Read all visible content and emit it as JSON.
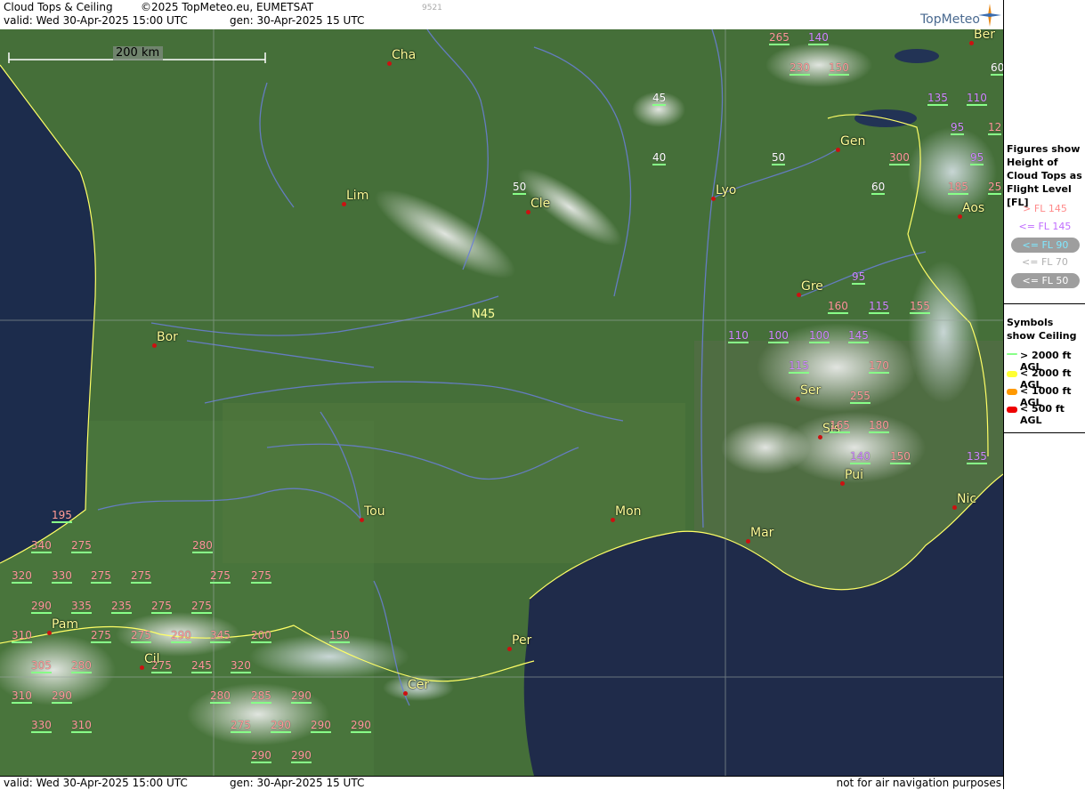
{
  "header": {
    "title": "Cloud Tops & Ceiling",
    "copyright": "©2025 TopMeteo.eu, EUMETSAT",
    "valid": "valid:  Wed  30-Apr-2025  15:00 UTC",
    "generated": "gen: 30-Apr-2025 15 UTC",
    "image_id": "9521",
    "brand": "TopMeteo"
  },
  "map": {
    "scale_label": "200 km",
    "lat_label": "N45",
    "cities": [
      {
        "name": "Cha"
      },
      {
        "name": "Lim"
      },
      {
        "name": "Cle"
      },
      {
        "name": "Lyo"
      },
      {
        "name": "Gen"
      },
      {
        "name": "Ber"
      },
      {
        "name": "Aos"
      },
      {
        "name": "Gre"
      },
      {
        "name": "Bor"
      },
      {
        "name": "Ser"
      },
      {
        "name": "Sis"
      },
      {
        "name": "Pui"
      },
      {
        "name": "Tou"
      },
      {
        "name": "Mon"
      },
      {
        "name": "Mar"
      },
      {
        "name": "Nic"
      },
      {
        "name": "Pam"
      },
      {
        "name": "Cil"
      },
      {
        "name": "Per"
      },
      {
        "name": "Cer"
      }
    ],
    "cloud_tops": [
      {
        "v": "265",
        "c": "pink"
      },
      {
        "v": "140",
        "c": "violet"
      },
      {
        "v": "230",
        "c": "pink"
      },
      {
        "v": "150",
        "c": "pink"
      },
      {
        "v": "60",
        "c": "white"
      },
      {
        "v": "135",
        "c": "violet"
      },
      {
        "v": "110",
        "c": "violet"
      },
      {
        "v": "45",
        "c": "white"
      },
      {
        "v": "95",
        "c": "violet"
      },
      {
        "v": "12",
        "c": "pink"
      },
      {
        "v": "40",
        "c": "white"
      },
      {
        "v": "50",
        "c": "white"
      },
      {
        "v": "300",
        "c": "pink"
      },
      {
        "v": "95",
        "c": "violet"
      },
      {
        "v": "50",
        "c": "white"
      },
      {
        "v": "60",
        "c": "white"
      },
      {
        "v": "185",
        "c": "pink"
      },
      {
        "v": "25",
        "c": "pink"
      },
      {
        "v": "95",
        "c": "violet"
      },
      {
        "v": "160",
        "c": "pink"
      },
      {
        "v": "115",
        "c": "violet"
      },
      {
        "v": "155",
        "c": "pink"
      },
      {
        "v": "110",
        "c": "violet"
      },
      {
        "v": "100",
        "c": "violet"
      },
      {
        "v": "100",
        "c": "violet"
      },
      {
        "v": "145",
        "c": "violet"
      },
      {
        "v": "115",
        "c": "violet"
      },
      {
        "v": "170",
        "c": "pink"
      },
      {
        "v": "255",
        "c": "pink"
      },
      {
        "v": "165",
        "c": "pink"
      },
      {
        "v": "180",
        "c": "pink"
      },
      {
        "v": "140",
        "c": "violet"
      },
      {
        "v": "150",
        "c": "pink"
      },
      {
        "v": "135",
        "c": "violet"
      },
      {
        "v": "195",
        "c": "pink"
      },
      {
        "v": "340",
        "c": "pink"
      },
      {
        "v": "275",
        "c": "pink"
      },
      {
        "v": "280",
        "c": "pink"
      },
      {
        "v": "320",
        "c": "pink"
      },
      {
        "v": "330",
        "c": "pink"
      },
      {
        "v": "275",
        "c": "pink"
      },
      {
        "v": "275",
        "c": "pink"
      },
      {
        "v": "275",
        "c": "pink"
      },
      {
        "v": "275",
        "c": "pink"
      },
      {
        "v": "290",
        "c": "pink"
      },
      {
        "v": "335",
        "c": "pink"
      },
      {
        "v": "235",
        "c": "pink"
      },
      {
        "v": "275",
        "c": "pink"
      },
      {
        "v": "275",
        "c": "pink"
      },
      {
        "v": "310",
        "c": "pink"
      },
      {
        "v": "275",
        "c": "pink"
      },
      {
        "v": "275",
        "c": "pink"
      },
      {
        "v": "290",
        "c": "pink"
      },
      {
        "v": "345",
        "c": "pink"
      },
      {
        "v": "200",
        "c": "pink"
      },
      {
        "v": "150",
        "c": "pink"
      },
      {
        "v": "305",
        "c": "pink"
      },
      {
        "v": "280",
        "c": "pink"
      },
      {
        "v": "275",
        "c": "pink"
      },
      {
        "v": "245",
        "c": "pink"
      },
      {
        "v": "320",
        "c": "pink"
      },
      {
        "v": "310",
        "c": "pink"
      },
      {
        "v": "290",
        "c": "pink"
      },
      {
        "v": "280",
        "c": "pink"
      },
      {
        "v": "285",
        "c": "pink"
      },
      {
        "v": "290",
        "c": "pink"
      },
      {
        "v": "330",
        "c": "pink"
      },
      {
        "v": "310",
        "c": "pink"
      },
      {
        "v": "275",
        "c": "pink"
      },
      {
        "v": "290",
        "c": "pink"
      },
      {
        "v": "290",
        "c": "pink"
      },
      {
        "v": "290",
        "c": "pink"
      },
      {
        "v": "290",
        "c": "pink"
      },
      {
        "v": "290",
        "c": "pink"
      }
    ]
  },
  "legend": {
    "figures_title": "Figures show Height of Cloud Tops as Flight Level  [FL]",
    "fl_items": [
      {
        "label": "> FL 145",
        "color": "#ff8a8a",
        "pill": false
      },
      {
        "label": "<= FL 145",
        "color": "#c06cff",
        "pill": false
      },
      {
        "label": "<= FL 90",
        "color": "#7fe8ff",
        "pill": true
      },
      {
        "label": "<= FL 70",
        "color": "#b0b0b0",
        "pill": false
      },
      {
        "label": "<= FL 50",
        "color": "#ffffff",
        "pill": true
      }
    ],
    "symbols_title": "Symbols show Ceiling",
    "ceiling_items": [
      {
        "label": "> 2000 ft AGL",
        "color": "#88ff88"
      },
      {
        "label": "< 2000 ft AGL",
        "color": "#ffff33"
      },
      {
        "label": "< 1000 ft AGL",
        "color": "#ff9900"
      },
      {
        "label": "< 500 ft AGL",
        "color": "#ee0000"
      }
    ]
  },
  "footer": {
    "valid": "valid:  Wed  30-Apr-2025  15:00 UTC",
    "generated": "gen: 30-Apr-2025 15 UTC",
    "disclaimer": "not for air navigation purposes"
  }
}
